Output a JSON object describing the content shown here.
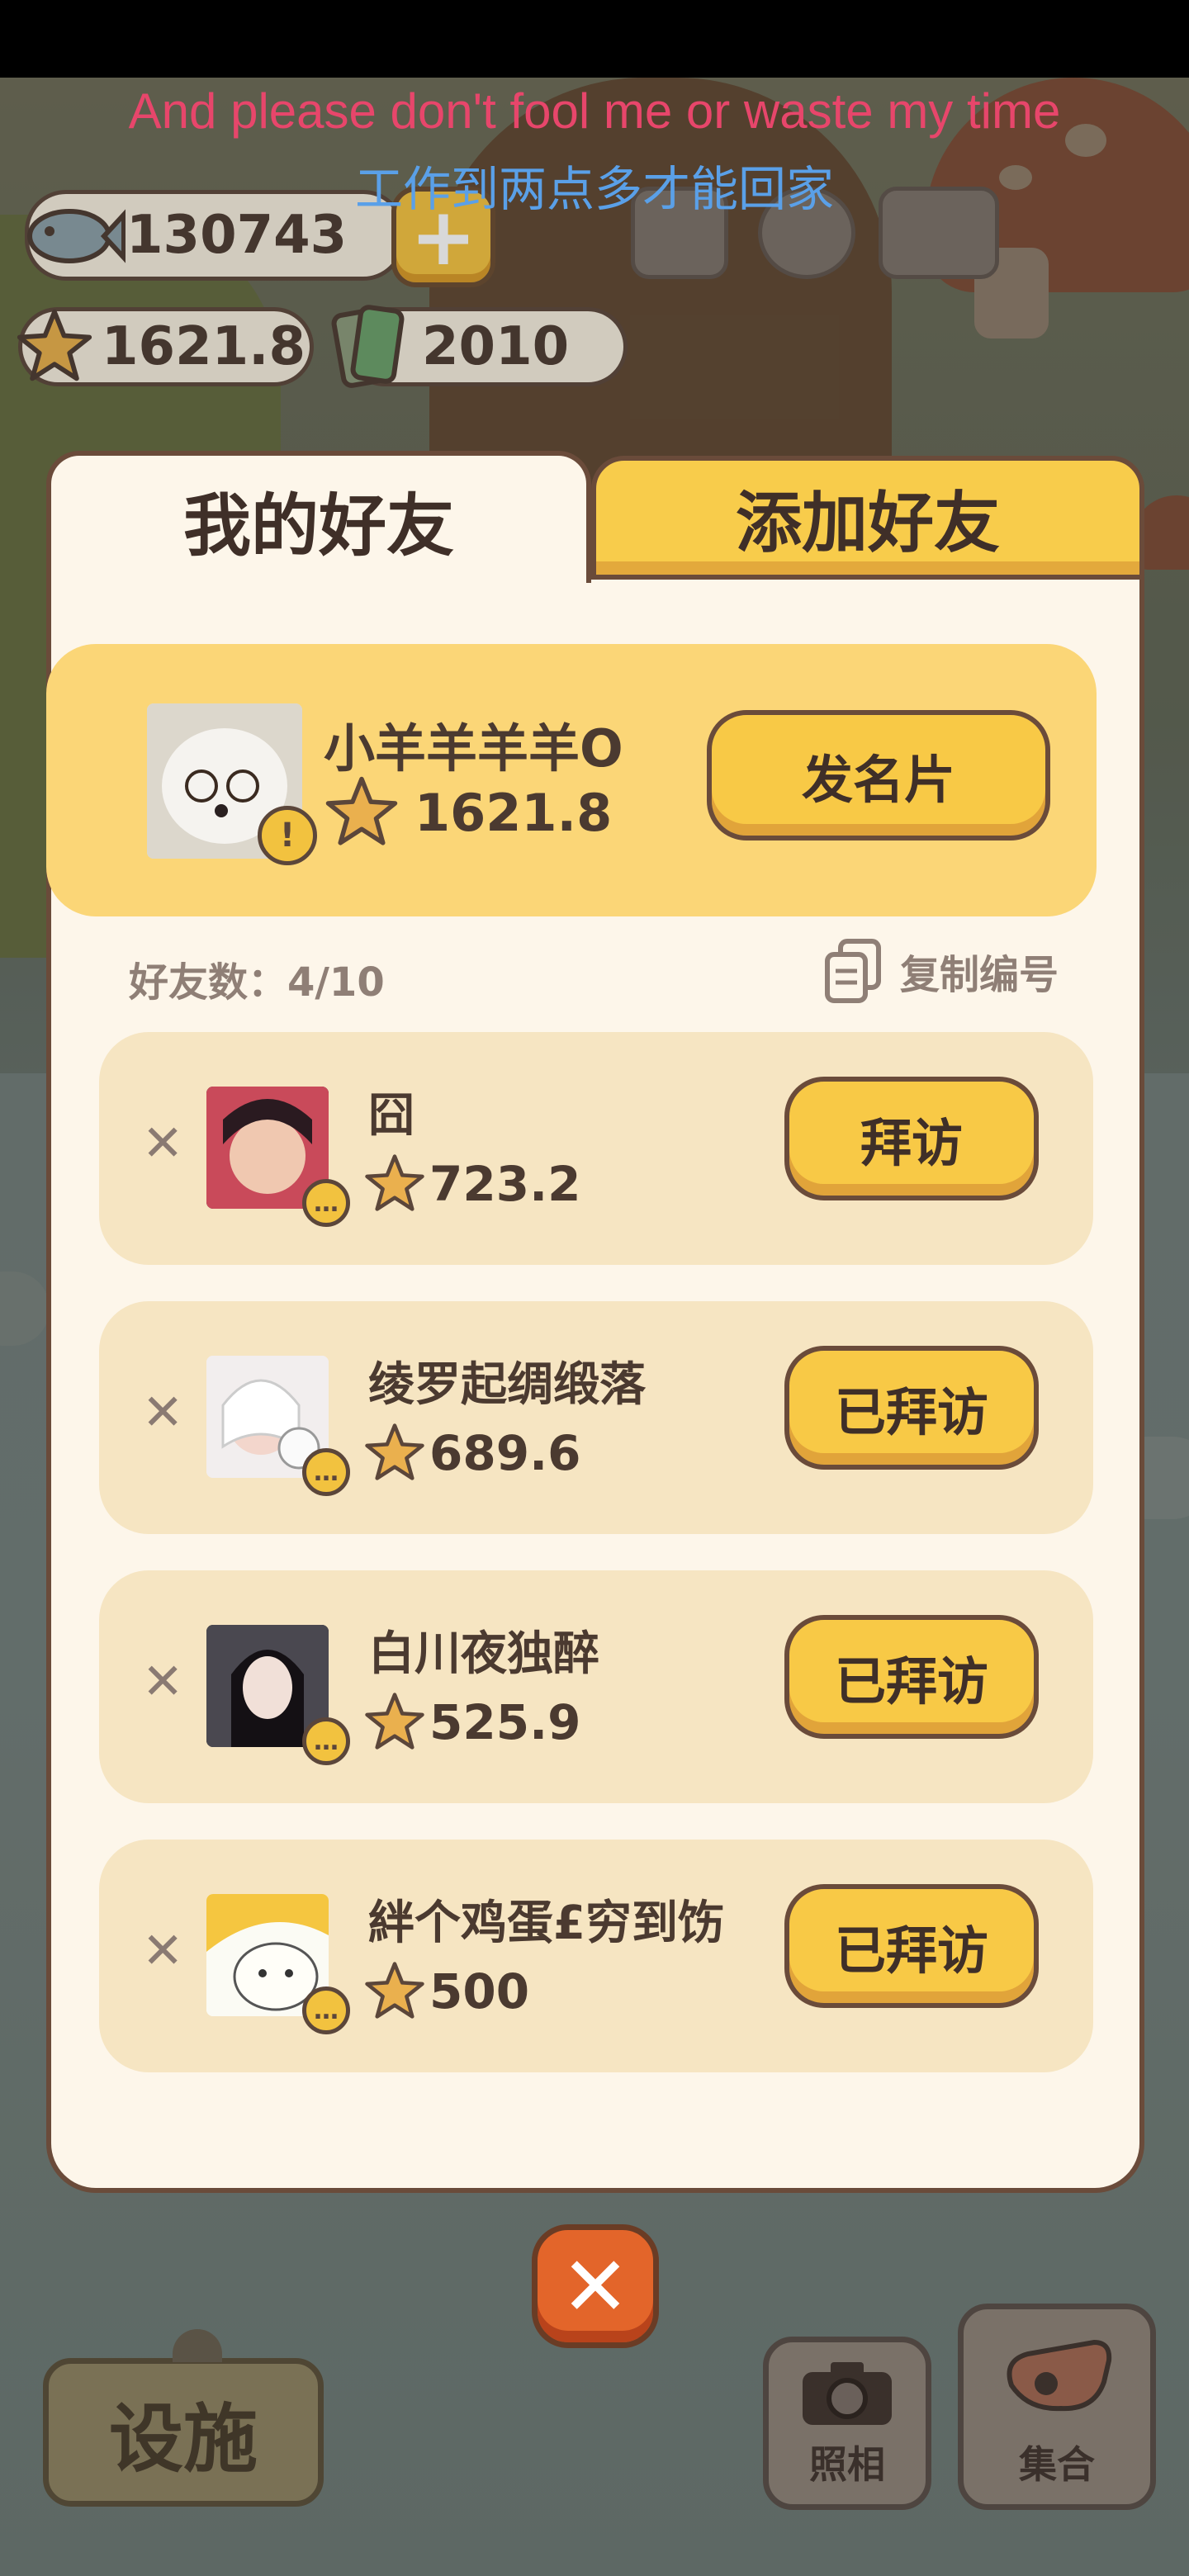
{
  "captions": {
    "english": "And please don't fool me or waste my time",
    "chinese": "工作到两点多才能回家"
  },
  "currency": {
    "fish": "130743",
    "stars": "1621.8",
    "tickets": "2010",
    "plus_label": "+"
  },
  "tabs": {
    "my_friends": "我的好友",
    "add_friend": "添加好友"
  },
  "me": {
    "name": "小羊羊羊羊O",
    "score": "1621.8",
    "badge": "!",
    "card_button": "发名片"
  },
  "friend_count": "好友数：4/10",
  "copy_id": "复制编号",
  "friends": [
    {
      "name": "囧",
      "score": "723.2",
      "button": "拜访"
    },
    {
      "name": "绫罗起绸缎落",
      "score": "689.6",
      "button": "已拜访"
    },
    {
      "name": "白川夜独醉",
      "score": "525.9",
      "button": "已拜访"
    },
    {
      "name": "絆个鸡蛋£穷到饬",
      "score": "500",
      "button": "已拜访"
    }
  ],
  "bottom": {
    "facility": "设施",
    "photo": "照相",
    "gather": "集合",
    "close": "✕"
  },
  "icons": [
    "fish-icon",
    "star-icon",
    "ticket-icon",
    "ranking-icon",
    "gear-icon",
    "paw-book-icon",
    "copy-icon",
    "camera-icon",
    "whistle-icon",
    "more-icon"
  ]
}
